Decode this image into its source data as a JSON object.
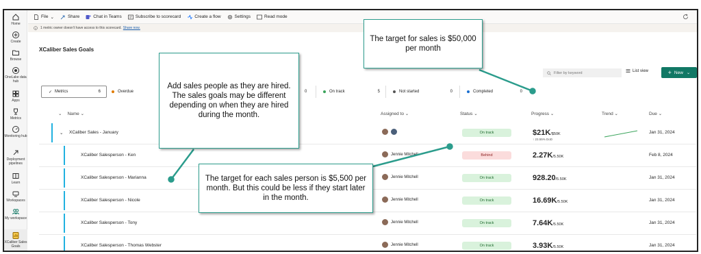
{
  "rail": {
    "items": [
      {
        "label": "Home",
        "icon": "home-icon"
      },
      {
        "label": "Create",
        "icon": "plus-circle-icon"
      },
      {
        "label": "Browse",
        "icon": "folder-icon"
      },
      {
        "label": "OneLake data hub",
        "icon": "onelake-icon"
      },
      {
        "label": "Apps",
        "icon": "apps-icon"
      },
      {
        "label": "Metrics",
        "icon": "trophy-icon"
      },
      {
        "label": "Monitoring hub",
        "icon": "monitor-icon"
      },
      {
        "label": "Deployment pipelines",
        "icon": "rocket-icon"
      },
      {
        "label": "Learn",
        "icon": "book-icon"
      },
      {
        "label": "Workspaces",
        "icon": "workspaces-icon"
      },
      {
        "label": "My workspace",
        "icon": "people-icon"
      },
      {
        "label": "XCaliber Sales Goals",
        "icon": "scorecard-icon"
      }
    ]
  },
  "toolbar": {
    "file": "File",
    "share": "Share",
    "chat": "Chat in Teams",
    "subscribe": "Subscribe to scorecard",
    "flow": "Create a flow",
    "settings": "Settings",
    "readmode": "Read mode"
  },
  "notice": {
    "text": "1 metric owner doesn't have access to this scorecard.",
    "link": "Share now."
  },
  "scorecard": {
    "title": "XCaliber Sales Goals",
    "filter_placeholder": "Filter by keyword",
    "list_view": "List view",
    "new_label": "New"
  },
  "chips": {
    "metrics": {
      "label": "Metrics",
      "count": "6"
    },
    "overdue": {
      "label": "Overdue"
    },
    "hidden_count": "0",
    "ontrack": {
      "label": "On track",
      "count": "5"
    },
    "notstarted": {
      "label": "Not started",
      "count": "0"
    },
    "completed": {
      "label": "Completed",
      "count": "0"
    }
  },
  "table": {
    "headers": {
      "name": "Name",
      "assigned": "Assigned to",
      "status": "Status",
      "progress": "Progress",
      "trend": "Trend",
      "due": "Due"
    },
    "rows": [
      {
        "name": "XCaliber Sales - January",
        "assignee": "",
        "status": "On track",
        "value": "$21K",
        "target": "/$50K",
        "sub": "↑ 23.55% DoD",
        "due": "Jan 31, 2024"
      },
      {
        "name": "XCaliber Salesperson - Ken",
        "assignee": "Jennie Mitchell",
        "status": "Behind",
        "value": "2.27K",
        "target": "/5.50K",
        "due": "Feb 8, 2024"
      },
      {
        "name": "XCaliber Salesperson - Marianna",
        "assignee": "Jennie Mitchell",
        "status": "On track",
        "value": "928.20",
        "target": "/5.50K",
        "due": "Jan 31, 2024"
      },
      {
        "name": "XCaliber Salesperson - Nicole",
        "assignee": "Jennie Mitchell",
        "status": "On track",
        "value": "16.69K",
        "target": "/5.50K",
        "due": "Jan 31, 2024"
      },
      {
        "name": "XCaliber Salesperson - Tony",
        "assignee": "Jennie Mitchell",
        "status": "On track",
        "value": "7.64K",
        "target": "/5.50K",
        "due": "Jan 31, 2024"
      },
      {
        "name": "XCaliber Salesperson - Thomas Webster",
        "assignee": "Jennie Mitchell",
        "status": "On track",
        "value": "3.93K",
        "target": "/5.50K",
        "due": "Jan 31, 2024"
      }
    ]
  },
  "callouts": {
    "sales_target": "The target for sales is $50,000 per month",
    "hired": "Add sales people as they are hired.  The sales goals may be different depending on when they are hired during the month.",
    "person_target": "The target for each sales person is $5,500 per month.  But this could be less if they start later in the month."
  },
  "colors": {
    "accent": "#117865",
    "bar": "#20b1e0",
    "callout_border": "#2b9c8c",
    "on_track": "#d9f2dc",
    "behind": "#fbdcdc"
  }
}
